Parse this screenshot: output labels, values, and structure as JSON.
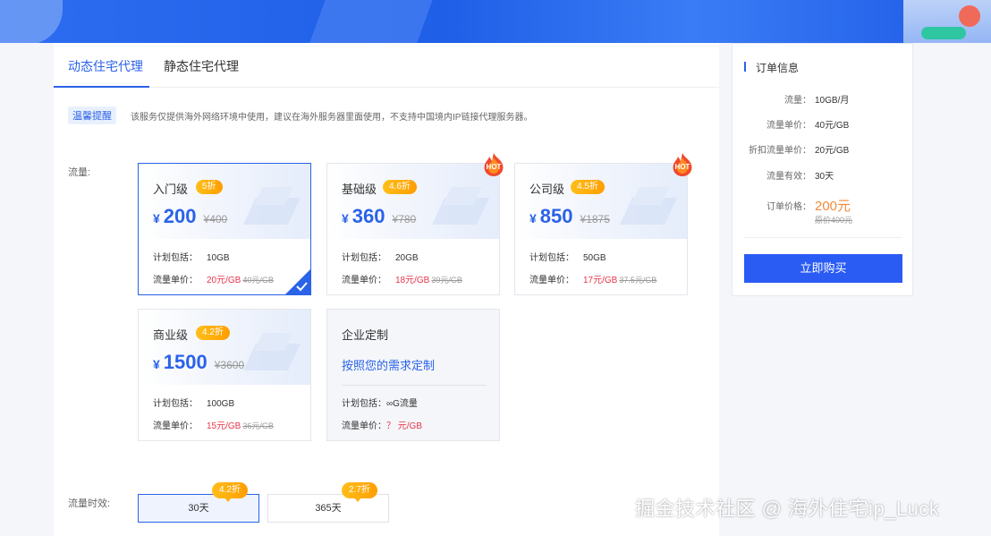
{
  "tabs": {
    "dynamic": "动态住宅代理",
    "static": "静态住宅代理"
  },
  "notice": {
    "badge": "温馨提醒",
    "text": "该服务仅提供海外网络环境中使用，建议在海外服务器里面使用，不支持中国境内IP链接代理服务器。"
  },
  "labels": {
    "traffic": "流量:",
    "validity": "流量时效:"
  },
  "packages": [
    {
      "name": "入门级",
      "discount": "5折",
      "currency": "¥",
      "price": "200",
      "original": "¥400",
      "plan_label": "计划包括：",
      "plan_value": "10GB",
      "unit_label": "流量单价：",
      "unit_price": "20元/GB",
      "unit_old": "40元/GB",
      "hot": false,
      "selected": true
    },
    {
      "name": "基础级",
      "discount": "4.6折",
      "currency": "¥",
      "price": "360",
      "original": "¥780",
      "plan_label": "计划包括：",
      "plan_value": "20GB",
      "unit_label": "流量单价：",
      "unit_price": "18元/GB",
      "unit_old": "39元/GB",
      "hot": true,
      "selected": false
    },
    {
      "name": "公司级",
      "discount": "4.5折",
      "currency": "¥",
      "price": "850",
      "original": "¥1875",
      "plan_label": "计划包括：",
      "plan_value": "50GB",
      "unit_label": "流量单价：",
      "unit_price": "17元/GB",
      "unit_old": "37.5元/GB",
      "hot": true,
      "selected": false
    },
    {
      "name": "商业级",
      "discount": "4.2折",
      "currency": "¥",
      "price": "1500",
      "original": "¥3600",
      "plan_label": "计划包括：",
      "plan_value": "100GB",
      "unit_label": "流量单价：",
      "unit_price": "15元/GB",
      "unit_old": "36元/GB",
      "hot": false,
      "selected": false
    }
  ],
  "custom": {
    "title": "企业定制",
    "subtitle": "按照您的需求定制",
    "plan_label": "计划包括：",
    "plan_value": "∞G流量",
    "unit_label": "流量单价：",
    "unit_price": "？ 元/GB"
  },
  "durations": [
    {
      "label": "30天",
      "tag": "4.2折",
      "selected": true
    },
    {
      "label": "365天",
      "tag": "2.7折",
      "selected": false
    }
  ],
  "order": {
    "title": "订单信息",
    "rows": [
      {
        "k": "流量：",
        "v": "10GB/月"
      },
      {
        "k": "流量单价：",
        "v": "40元/GB"
      },
      {
        "k": "折扣流量单价：",
        "v": "20元/GB"
      },
      {
        "k": "流量有效：",
        "v": "30天"
      }
    ],
    "total_label": "订单价格：",
    "total": "200元",
    "total_old": "原价400元",
    "buy": "立即购买"
  },
  "watermark": "掘金技术社区 @ 海外住宅ip_Luck",
  "colors": {
    "accent": "#2a62e8",
    "discount_tag": "#ffa90a",
    "unit_price": "#e8354b",
    "total": "#f08a3c",
    "buy_button": "#2a5cf4"
  },
  "icons": {
    "hot": "hot-flame-icon",
    "check": "check-corner-icon"
  }
}
